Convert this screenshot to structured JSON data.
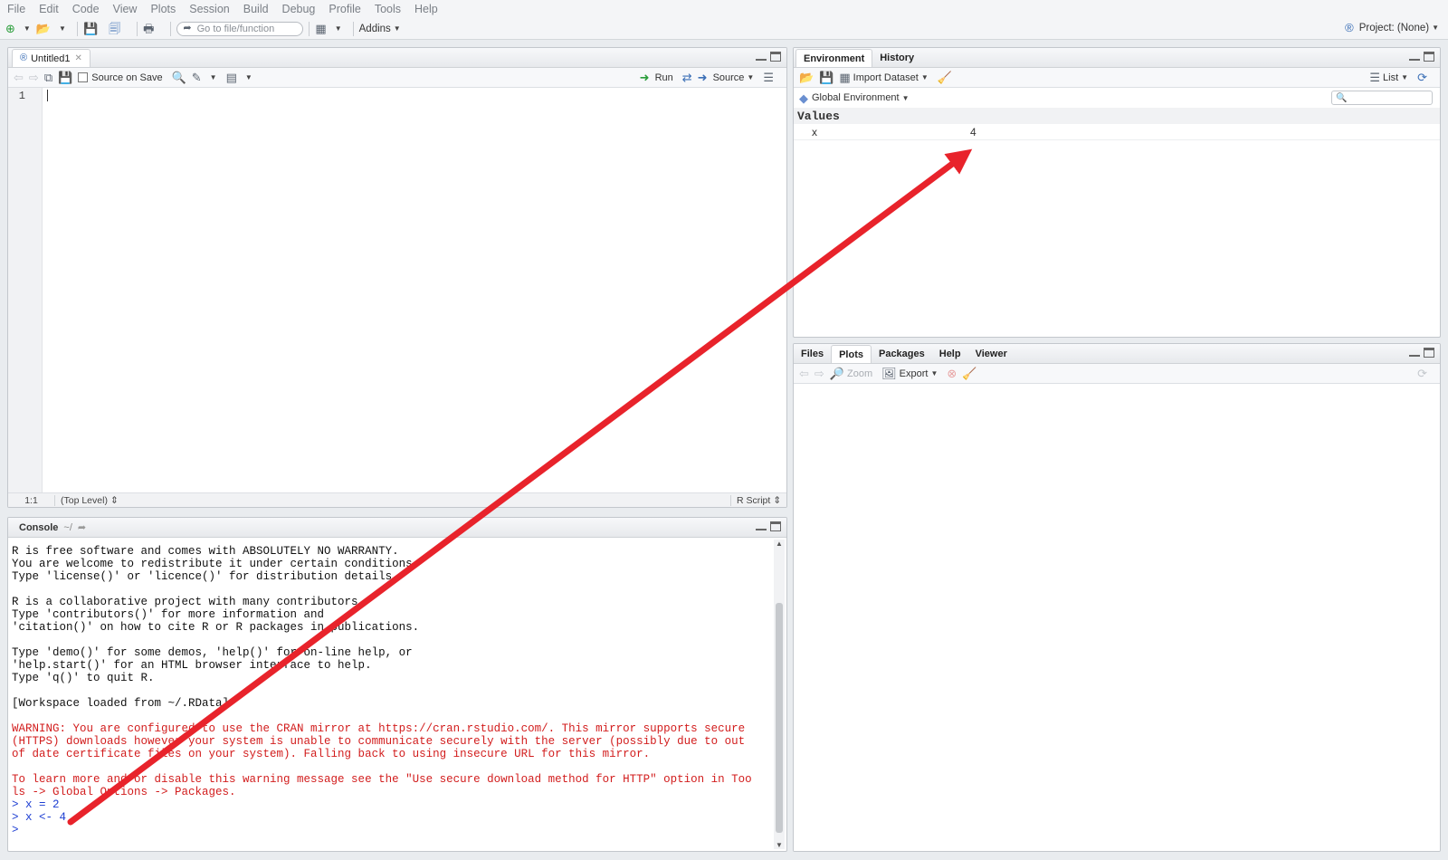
{
  "menu": [
    "File",
    "Edit",
    "Code",
    "View",
    "Plots",
    "Session",
    "Build",
    "Debug",
    "Profile",
    "Tools",
    "Help"
  ],
  "toolbar": {
    "goto_placeholder": "Go to file/function",
    "addins_label": "Addins",
    "project_label": "Project: (None)"
  },
  "editor": {
    "tab_label": "Untitled1",
    "source_on_save_label": "Source on Save",
    "run_label": "Run",
    "source_label": "Source",
    "line_number": "1",
    "status_position": "1:1",
    "status_scope": "(Top Level)",
    "status_type": "R Script"
  },
  "console": {
    "tab_label": "Console",
    "path": "~/",
    "lines": [
      {
        "text": "R is free software and comes with ABSOLUTELY NO WARRANTY.",
        "kind": "normal"
      },
      {
        "text": "You are welcome to redistribute it under certain conditions.",
        "kind": "normal"
      },
      {
        "text": "Type 'license()' or 'licence()' for distribution details.",
        "kind": "normal"
      },
      {
        "text": "",
        "kind": "normal"
      },
      {
        "text": "R is a collaborative project with many contributors.",
        "kind": "normal"
      },
      {
        "text": "Type 'contributors()' for more information and",
        "kind": "normal"
      },
      {
        "text": "'citation()' on how to cite R or R packages in publications.",
        "kind": "normal"
      },
      {
        "text": "",
        "kind": "normal"
      },
      {
        "text": "Type 'demo()' for some demos, 'help()' for on-line help, or",
        "kind": "normal"
      },
      {
        "text": "'help.start()' for an HTML browser interface to help.",
        "kind": "normal"
      },
      {
        "text": "Type 'q()' to quit R.",
        "kind": "normal"
      },
      {
        "text": "",
        "kind": "normal"
      },
      {
        "text": "[Workspace loaded from ~/.RData]",
        "kind": "normal"
      },
      {
        "text": "",
        "kind": "normal"
      },
      {
        "text": "WARNING: You are configured to use the CRAN mirror at https://cran.rstudio.com/. This mirror supports secure",
        "kind": "warn"
      },
      {
        "text": "(HTTPS) downloads however your system is unable to communicate securely with the server (possibly due to out",
        "kind": "warn"
      },
      {
        "text": "of date certificate files on your system). Falling back to using insecure URL for this mirror.",
        "kind": "warn"
      },
      {
        "text": "",
        "kind": "normal"
      },
      {
        "text": "To learn more and/or disable this warning message see the \"Use secure download method for HTTP\" option in Too",
        "kind": "warn"
      },
      {
        "text": "ls -> Global Options -> Packages.",
        "kind": "warn"
      },
      {
        "text": "> x = 2",
        "kind": "input"
      },
      {
        "text": "> x <- 4",
        "kind": "input"
      },
      {
        "text": "> ",
        "kind": "input"
      }
    ]
  },
  "environment": {
    "tabs": [
      "Environment",
      "History"
    ],
    "import_label": "Import Dataset",
    "list_label": "List",
    "scope_label": "Global Environment",
    "values_heading": "Values",
    "rows": [
      {
        "name": "x",
        "value": "4"
      }
    ]
  },
  "files": {
    "tabs": [
      "Files",
      "Plots",
      "Packages",
      "Help",
      "Viewer"
    ],
    "zoom_label": "Zoom",
    "export_label": "Export"
  },
  "colors": {
    "annotation_arrow": "#e8232b",
    "console_warning": "#d21d1d",
    "console_input": "#1d3ed2"
  }
}
